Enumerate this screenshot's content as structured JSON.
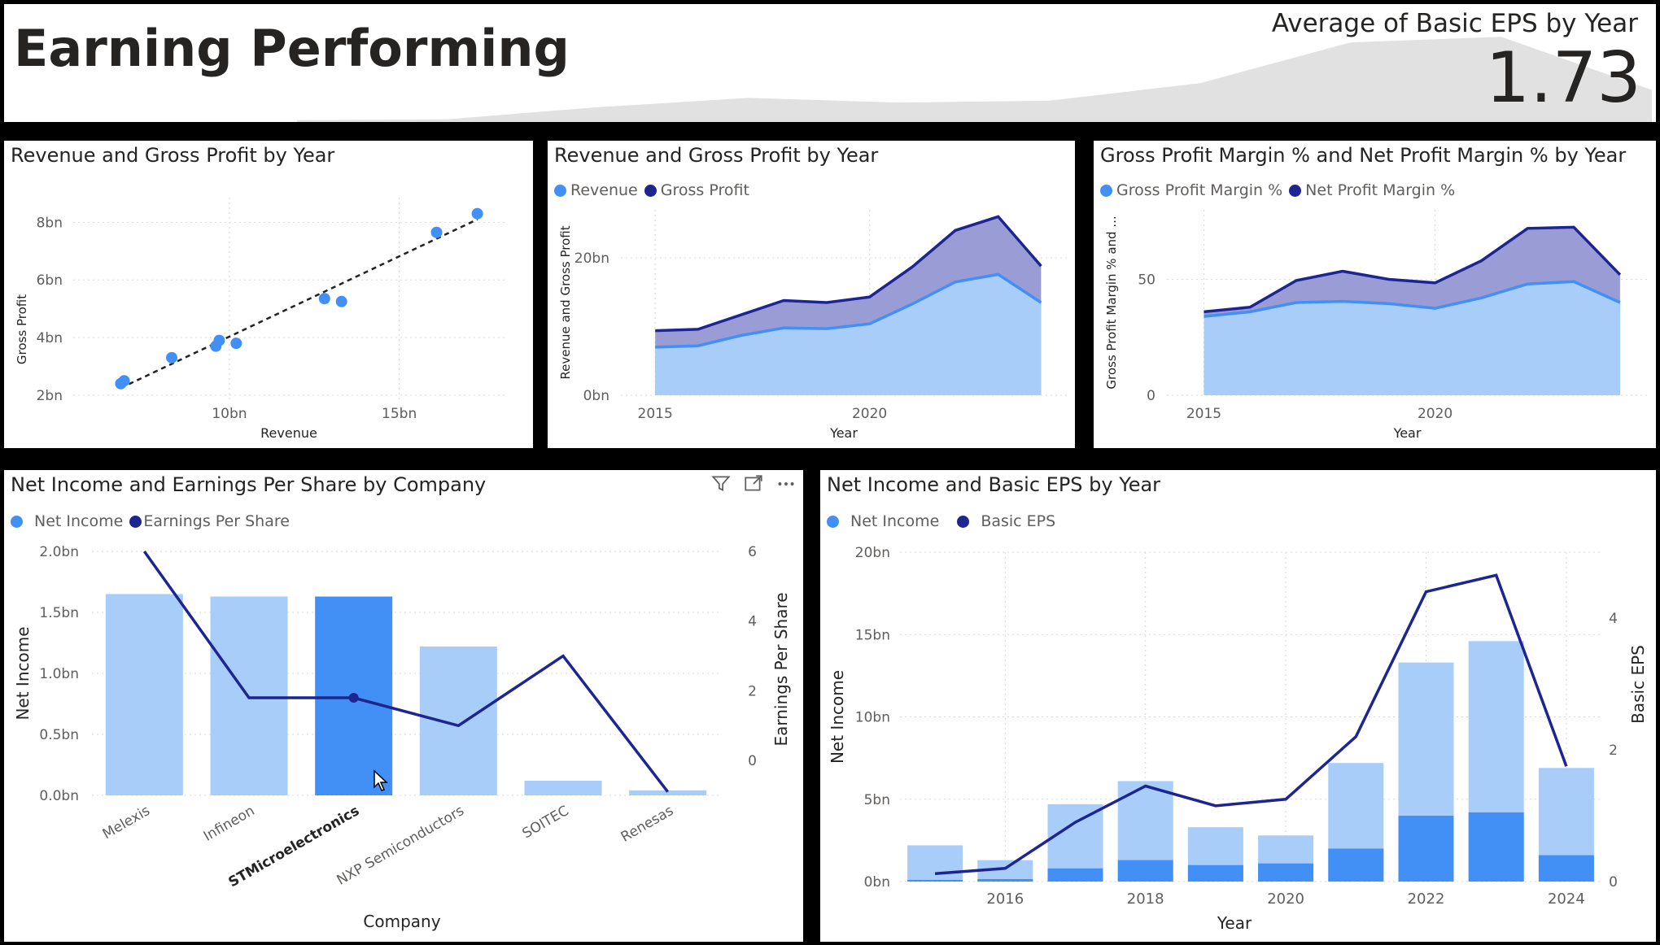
{
  "header": {
    "title": "Earning Performing",
    "kpi_title": "Average of Basic EPS by Year",
    "kpi_value": "1.73"
  },
  "colors": {
    "light_blue": "#A8CDF8",
    "mid_blue": "#4290F5",
    "dark_blue": "#1D2590",
    "grid": "#D9D9D9",
    "sparkline": "#E1E1E1"
  },
  "kpi_sparkline": {
    "values": [
      0.1,
      0.15,
      0.8,
      1.3,
      1.05,
      1.15,
      2.1,
      4.3,
      4.6,
      1.73
    ]
  },
  "panels": {
    "scatter": {
      "title": "Revenue and Gross Profit by Year",
      "xlabel": "Revenue",
      "ylabel": "Gross Profit"
    },
    "area_revenue": {
      "title": "Revenue and Gross Profit by Year",
      "legend": [
        "Revenue",
        "Gross Profit"
      ],
      "xlabel": "Year",
      "ylabel": "Revenue and Gross Profit"
    },
    "area_margin": {
      "title": "Gross Profit Margin % and Net Profit Margin % by Year",
      "legend": [
        "Gross Profit Margin %",
        "Net Profit Margin %"
      ],
      "xlabel": "Year",
      "ylabel": "Gross Profit Margin % and ..."
    },
    "company_combo": {
      "title": "Net Income and Earnings Per Share by Company",
      "legend": [
        "Net Income",
        "Earnings Per Share"
      ],
      "xlabel": "Company",
      "ylabel_left": "Net Income",
      "ylabel_right": "Earnings Per Share",
      "icons": [
        "filter-icon",
        "focus-mode-icon",
        "more-options-icon"
      ]
    },
    "year_combo": {
      "title": "Net Income and Basic EPS by Year",
      "legend": [
        "Net Income",
        "Basic EPS"
      ],
      "xlabel": "Year",
      "ylabel_left": "Net Income",
      "ylabel_right": "Basic EPS"
    }
  },
  "chart_data": [
    {
      "id": "scatter",
      "type": "scatter",
      "title": "Revenue and Gross Profit by Year",
      "xlabel": "Revenue",
      "ylabel": "Gross Profit",
      "x_ticks": [
        {
          "v": 10,
          "label": "10bn"
        },
        {
          "v": 15,
          "label": "15bn"
        }
      ],
      "y_ticks": [
        {
          "v": 2,
          "label": "2bn"
        },
        {
          "v": 4,
          "label": "4bn"
        },
        {
          "v": 6,
          "label": "6bn"
        },
        {
          "v": 8,
          "label": "8bn"
        }
      ],
      "xlim": [
        5.4,
        18.1
      ],
      "ylim": [
        1.8,
        8.8
      ],
      "points": [
        {
          "x": 6.8,
          "y": 2.4
        },
        {
          "x": 6.9,
          "y": 2.5
        },
        {
          "x": 8.3,
          "y": 3.3
        },
        {
          "x": 9.6,
          "y": 3.7
        },
        {
          "x": 9.7,
          "y": 3.9
        },
        {
          "x": 10.2,
          "y": 3.8
        },
        {
          "x": 12.8,
          "y": 5.35
        },
        {
          "x": 13.3,
          "y": 5.25
        },
        {
          "x": 16.1,
          "y": 7.65
        },
        {
          "x": 17.3,
          "y": 8.3
        }
      ],
      "trendline": [
        {
          "x": 6.8,
          "y": 2.25
        },
        {
          "x": 17.3,
          "y": 8.1
        }
      ]
    },
    {
      "id": "area_revenue",
      "type": "area",
      "title": "Revenue and Gross Profit by Year",
      "xlabel": "Year",
      "ylabel": "Revenue and Gross Profit",
      "x": [
        2015,
        2016,
        2017,
        2018,
        2019,
        2020,
        2021,
        2022,
        2023,
        2024
      ],
      "x_ticks": [
        {
          "v": 2015,
          "label": "2015"
        },
        {
          "v": 2020,
          "label": "2020"
        }
      ],
      "y_ticks": [
        {
          "v": 0,
          "label": "0bn"
        },
        {
          "v": 20,
          "label": "20bn"
        }
      ],
      "xlim": [
        2014.2,
        2024.6
      ],
      "ylim": [
        0,
        27
      ],
      "series": [
        {
          "name": "Revenue",
          "values": [
            7.0,
            7.2,
            8.7,
            9.8,
            9.7,
            10.4,
            13.3,
            16.5,
            17.6,
            13.5
          ]
        },
        {
          "name": "Gross Profit",
          "values": [
            9.4,
            9.6,
            11.7,
            13.8,
            13.5,
            14.3,
            18.7,
            24.0,
            26.0,
            18.8
          ]
        }
      ]
    },
    {
      "id": "area_margin",
      "type": "area",
      "title": "Gross Profit Margin % and Net Profit Margin % by Year",
      "xlabel": "Year",
      "ylabel": "Gross Profit Margin % and ...",
      "x": [
        2015,
        2016,
        2017,
        2018,
        2019,
        2020,
        2021,
        2022,
        2023,
        2024
      ],
      "x_ticks": [
        {
          "v": 2015,
          "label": "2015"
        },
        {
          "v": 2020,
          "label": "2020"
        }
      ],
      "y_ticks": [
        {
          "v": 0,
          "label": "0"
        },
        {
          "v": 50,
          "label": "50"
        }
      ],
      "xlim": [
        2014.2,
        2024.6
      ],
      "ylim": [
        0,
        80
      ],
      "series": [
        {
          "name": "Gross Profit Margin %",
          "values": [
            34,
            36,
            40,
            40.5,
            39.5,
            37.5,
            42,
            48,
            49,
            40
          ]
        },
        {
          "name": "Net Profit Margin %",
          "values": [
            36,
            38,
            49.5,
            53.5,
            50,
            48.5,
            58,
            72,
            72.5,
            52
          ]
        }
      ]
    },
    {
      "id": "company_combo",
      "type": "bar",
      "title": "Net Income and Earnings Per Share by Company",
      "xlabel": "Company",
      "ylabel": "Net Income",
      "y2label": "Earnings Per Share",
      "categories": [
        "Melexis",
        "Infineon",
        "STMicroelectronics",
        "NXP Semiconductors",
        "SOITEC",
        "Renesas"
      ],
      "selected": "STMicroelectronics",
      "y_ticks": [
        {
          "v": 0,
          "label": "0.0bn"
        },
        {
          "v": 0.5,
          "label": "0.5bn"
        },
        {
          "v": 1.0,
          "label": "1.0bn"
        },
        {
          "v": 1.5,
          "label": "1.5bn"
        },
        {
          "v": 2.0,
          "label": "2.0bn"
        }
      ],
      "y2_ticks": [
        {
          "v": 0,
          "label": "0"
        },
        {
          "v": 2,
          "label": "2"
        },
        {
          "v": 4,
          "label": "4"
        },
        {
          "v": 6,
          "label": "6"
        }
      ],
      "ylim": [
        0,
        2.0
      ],
      "y2lim": [
        -1,
        6
      ],
      "series": [
        {
          "name": "Net Income",
          "type": "bar",
          "values": [
            1.65,
            1.63,
            1.63,
            1.22,
            0.12,
            0.04
          ]
        },
        {
          "name": "Earnings Per Share",
          "type": "line",
          "axis": "right",
          "values": [
            6.0,
            1.8,
            1.8,
            1.0,
            3.0,
            -0.9
          ]
        }
      ]
    },
    {
      "id": "year_combo",
      "type": "bar",
      "title": "Net Income and Basic EPS by Year",
      "xlabel": "Year",
      "ylabel": "Net Income",
      "y2label": "Basic EPS",
      "categories": [
        "2015",
        "2016",
        "2017",
        "2018",
        "2019",
        "2020",
        "2021",
        "2022",
        "2023",
        "2024"
      ],
      "x_tick_labels": {
        "2016": "2016",
        "2018": "2018",
        "2020": "2020",
        "2022": "2022",
        "2024": "2024"
      },
      "y_ticks": [
        {
          "v": 0,
          "label": "0bn"
        },
        {
          "v": 5,
          "label": "5bn"
        },
        {
          "v": 10,
          "label": "10bn"
        },
        {
          "v": 15,
          "label": "15bn"
        },
        {
          "v": 20,
          "label": "20bn"
        }
      ],
      "y2_ticks": [
        {
          "v": 0,
          "label": "0"
        },
        {
          "v": 2,
          "label": "2"
        },
        {
          "v": 4,
          "label": "4"
        }
      ],
      "ylim": [
        0,
        20
      ],
      "y2lim": [
        0,
        5
      ],
      "series": [
        {
          "name": "Net Income",
          "type": "bar",
          "values": [
            2.2,
            1.3,
            4.7,
            6.1,
            3.3,
            2.8,
            7.2,
            13.3,
            14.6,
            6.9
          ]
        },
        {
          "name": "Net Income (selection)",
          "type": "bar_highlight",
          "values": [
            0.1,
            0.15,
            0.8,
            1.3,
            1.0,
            1.1,
            2.0,
            4.0,
            4.2,
            1.6
          ]
        },
        {
          "name": "Basic EPS",
          "type": "line",
          "axis": "right",
          "values": [
            0.12,
            0.2,
            0.9,
            1.45,
            1.15,
            1.25,
            2.2,
            4.4,
            4.65,
            1.75
          ]
        }
      ]
    }
  ]
}
